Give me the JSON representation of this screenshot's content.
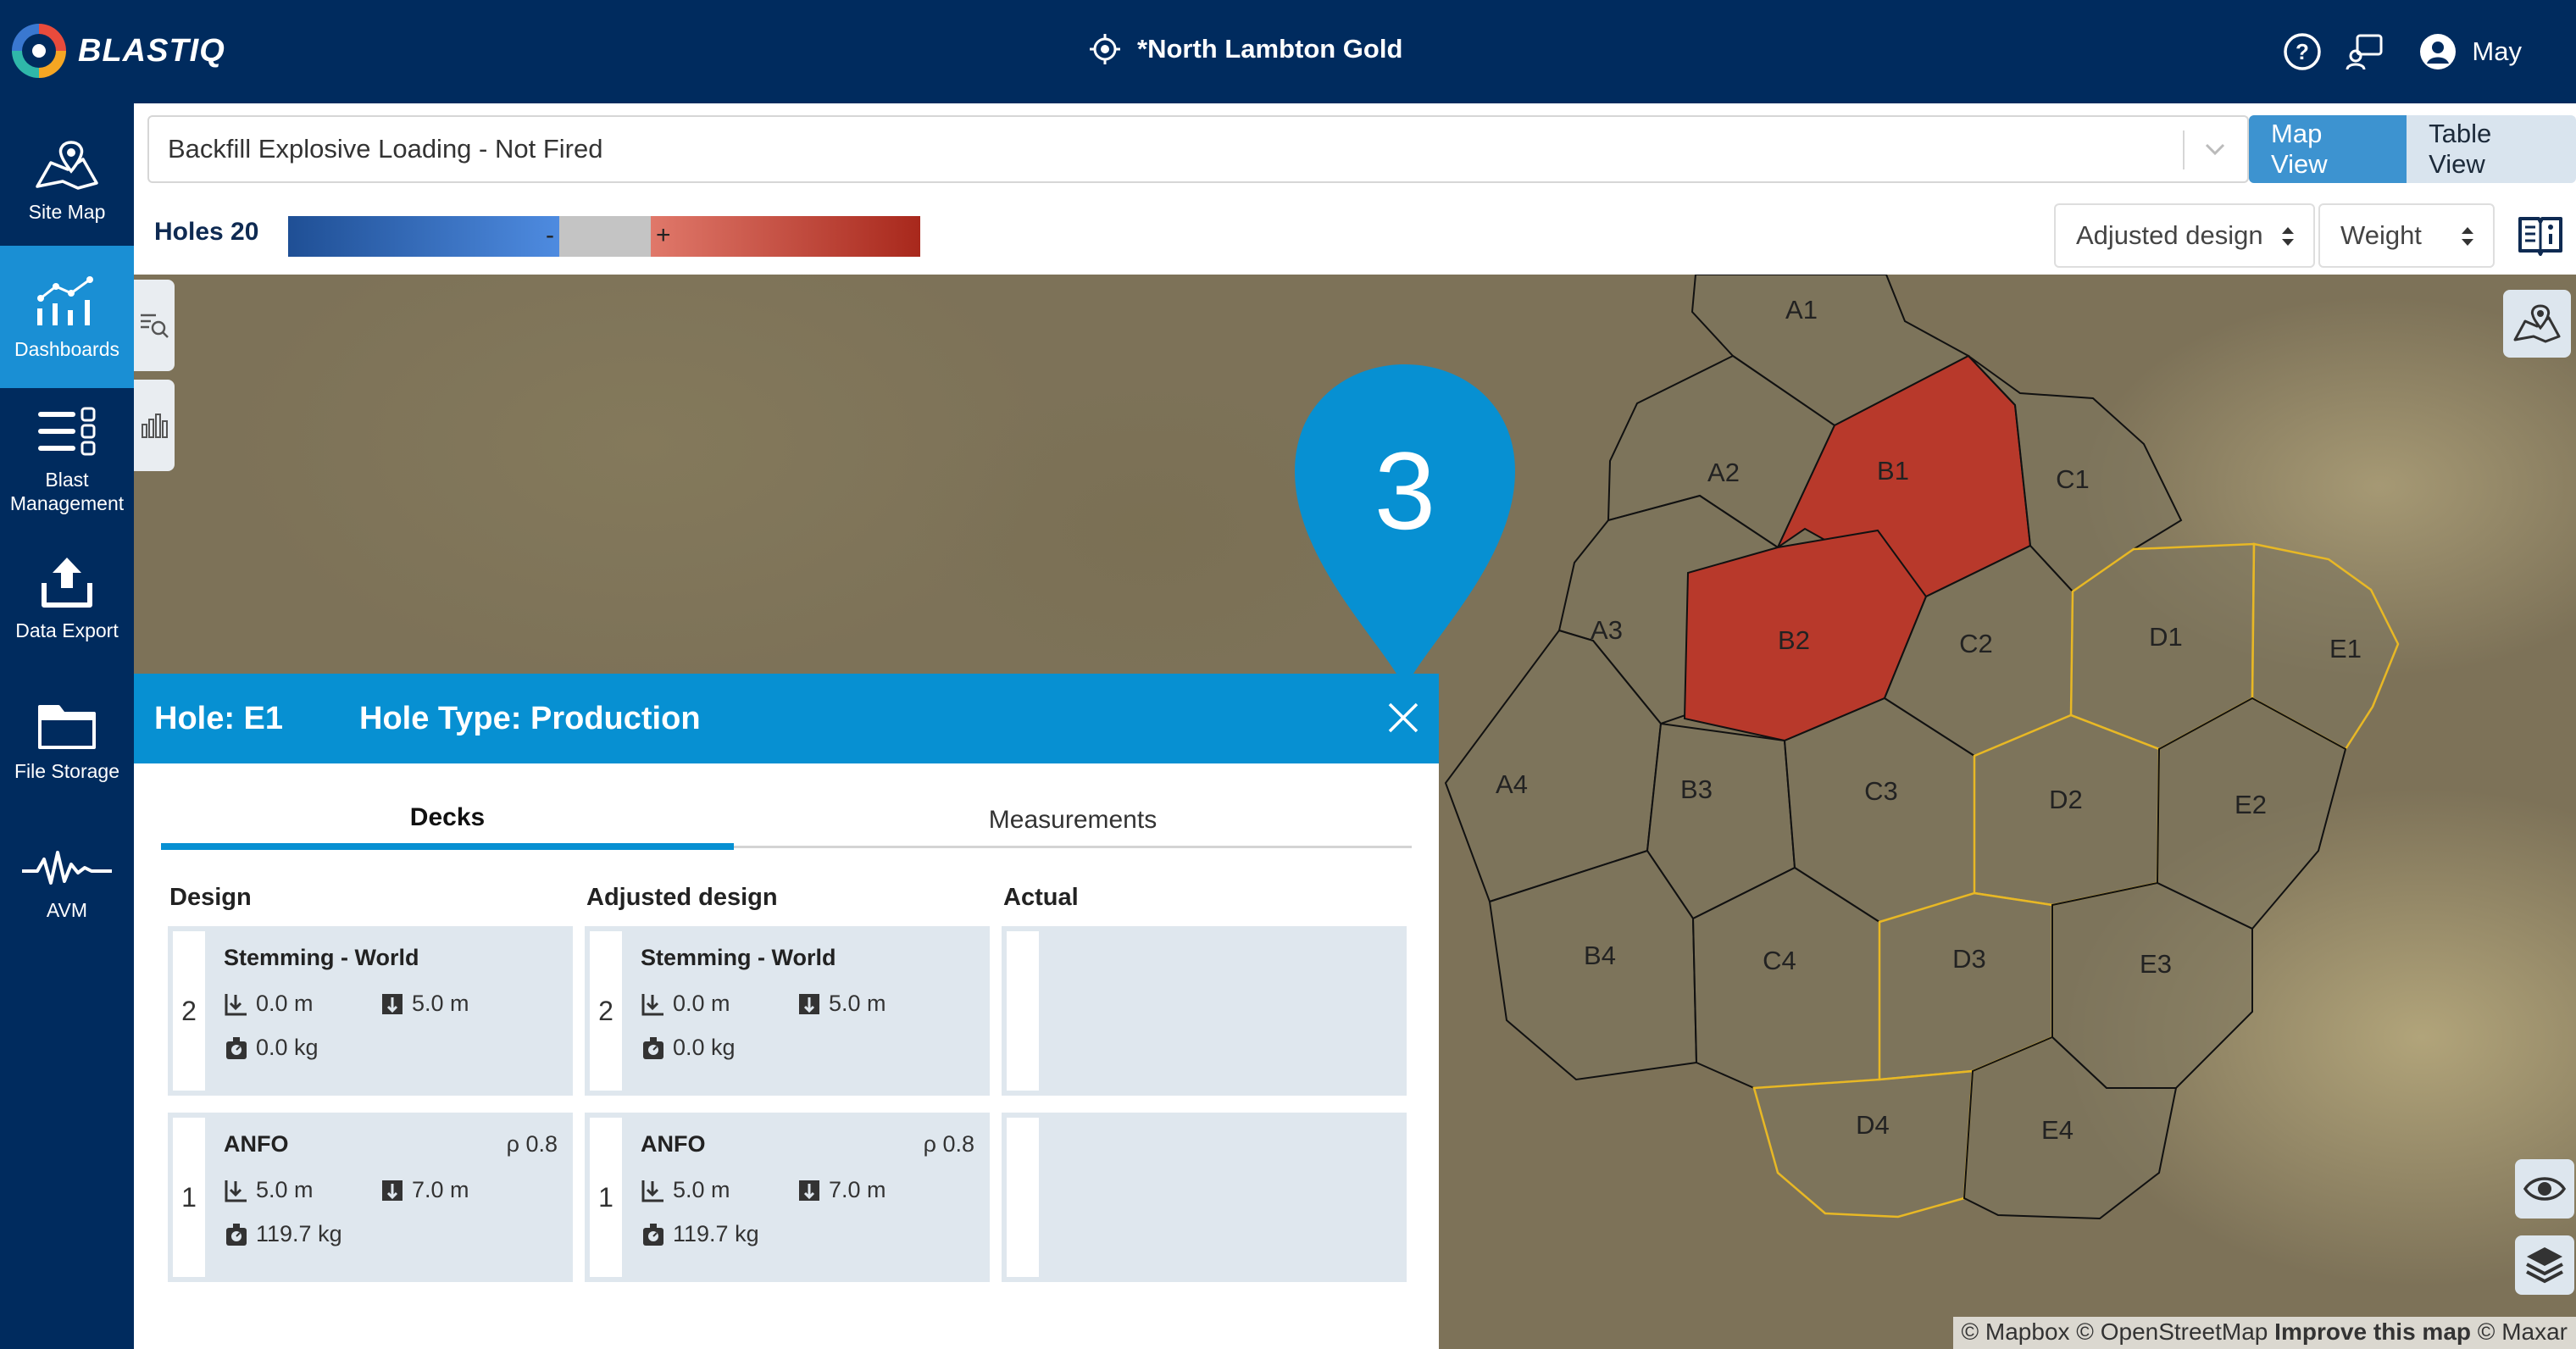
{
  "app": {
    "logo_text": "BLASTIQ",
    "site_title": "*North Lambton Gold",
    "user_name": "May"
  },
  "sidebar": {
    "items": [
      {
        "label": "Site Map",
        "icon": "map-icon"
      },
      {
        "label": "Dashboards",
        "icon": "dashboard-chart-icon"
      },
      {
        "label": "Blast\nManagement",
        "icon": "list-settings-icon"
      },
      {
        "label": "Data Export",
        "icon": "upload-icon"
      },
      {
        "label": "File Storage",
        "icon": "folder-icon"
      },
      {
        "label": "AVM",
        "icon": "waveform-icon"
      }
    ]
  },
  "controls": {
    "blast_select_value": "Backfill Explosive Loading - Not Fired",
    "map_view_label": "Map View",
    "table_view_label": "Table View",
    "holes_label": "Holes 20",
    "legend_minus": "-",
    "legend_plus": "+",
    "design_select_value": "Adjusted design",
    "metric_select_value": "Weight"
  },
  "map": {
    "marker_number": "3",
    "attribution_prefix": "© Mapbox © OpenStreetMap",
    "attribution_link": "Improve this map",
    "attribution_suffix": "© Maxar",
    "colors": {
      "positive": "#b8392b",
      "neutral_fill": "rgba(125,118,95,0.55)",
      "selected_outline": "#e8b825"
    },
    "holes": [
      "A1",
      "A2",
      "A3",
      "A4",
      "B1",
      "B2",
      "B3",
      "B4",
      "C1",
      "C2",
      "C3",
      "C4",
      "D1",
      "D2",
      "D3",
      "D4",
      "E1",
      "E2",
      "E3",
      "E4"
    ],
    "highlighted_holes": [
      "B1",
      "B2"
    ],
    "outlined_holes": [
      "D1",
      "D2",
      "D3",
      "D4",
      "E1"
    ]
  },
  "popup": {
    "hole_label": "Hole: E1",
    "hole_type_label": "Hole Type: Production",
    "tabs": [
      "Decks",
      "Measurements"
    ],
    "columns": [
      "Design",
      "Adjusted design",
      "Actual"
    ],
    "design": [
      {
        "num": "2",
        "name": "Stemming - World",
        "from": "0.0 m",
        "to": "5.0 m",
        "weight": "0.0 kg",
        "rho": ""
      },
      {
        "num": "1",
        "name": "ANFO",
        "from": "5.0 m",
        "to": "7.0 m",
        "weight": "119.7 kg",
        "rho": "ρ 0.8"
      }
    ],
    "adjusted": [
      {
        "num": "2",
        "name": "Stemming - World",
        "from": "0.0 m",
        "to": "5.0 m",
        "weight": "0.0 kg",
        "rho": ""
      },
      {
        "num": "1",
        "name": "ANFO",
        "from": "5.0 m",
        "to": "7.0 m",
        "weight": "119.7 kg",
        "rho": "ρ 0.8"
      }
    ]
  }
}
